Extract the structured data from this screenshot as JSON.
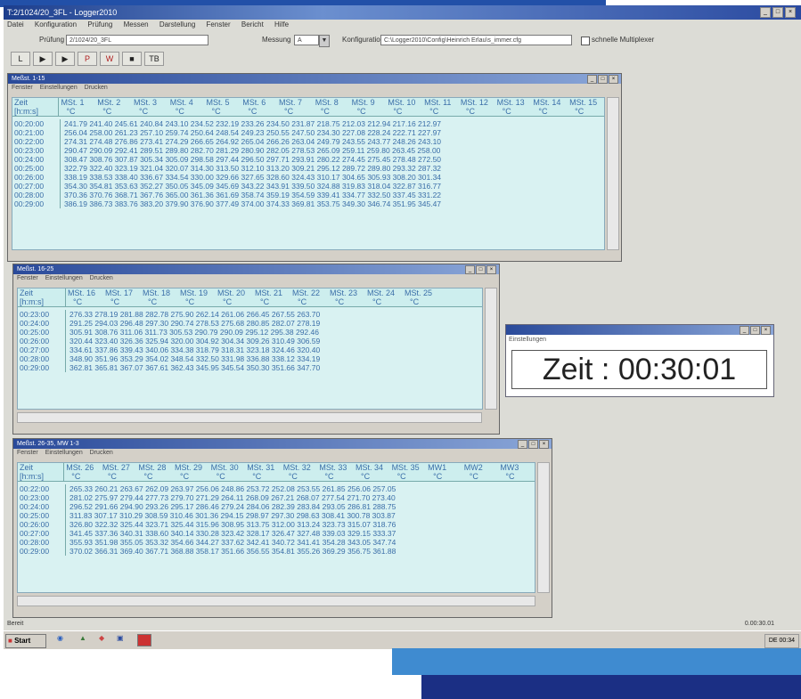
{
  "app": {
    "title": "T:2/1024/20_3FL - Logger2010",
    "menu": [
      "Datei",
      "Konfiguration",
      "Prüfung",
      "Messen",
      "Darstellung",
      "Fenster",
      "Bericht",
      "Hilfe"
    ],
    "pruefung_label": "Prüfung",
    "pruefung_value": "2/1024/20_3FL",
    "messung_label": "Messung",
    "messung_value": "A",
    "konfig_label": "Konfiguration",
    "konfig_value": "C:\\Logger2010\\Config\\Heinrich Erlau\\s_immer.cfg",
    "multiplexer_label": "schnelle Multiplexer",
    "toolbar": [
      "L",
      "▶",
      "▶",
      "P",
      "W",
      "■",
      "TB"
    ]
  },
  "win1": {
    "title": "Meßst. 1-15",
    "menu": [
      "Fenster",
      "Einstellungen",
      "Drucken"
    ],
    "time_header": [
      "Zeit",
      "[h:m:s]"
    ],
    "columns": [
      "MSt. 1",
      "MSt. 2",
      "MSt. 3",
      "MSt. 4",
      "MSt. 5",
      "MSt. 6",
      "MSt. 7",
      "MSt. 8",
      "MSt. 9",
      "MSt. 10",
      "MSt. 11",
      "MSt. 12",
      "MSt. 13",
      "MSt. 14",
      "MSt. 15"
    ],
    "unit": "°C",
    "rows": [
      {
        "t": "00:20:00",
        "v": "241.79 241.40 245.61 240.84 243.10 234.52 232.19 233.26 234.50 231.87 218.75 212.03 212.94 217.16 212.97"
      },
      {
        "t": "00:21:00",
        "v": "256.04 258.00 261.23 257.10 259.74 250.64 248.54 249.23 250.55 247.50 234.30 227.08 228.24 222.71 227.97"
      },
      {
        "t": "00:22:00",
        "v": "274.31 274.48 276.86 273.41 274.29 266.65 264.92 265.04 266.26 263.04 249.79 243.55 243.77 248.26 243.10"
      },
      {
        "t": "00:23:00",
        "v": "290.47 290.09 292.41 289.51 289.80 282.70 281.29 280.90 282.05 278.53 265.09 259.11 259.80 263.45 258.00"
      },
      {
        "t": "00:24:00",
        "v": "308.47 308.76 307.87 305.34 305.09 298.58 297.44 296.50 297.71 293.91 280.22 274.45 275.45 278.48 272.50"
      },
      {
        "t": "00:25:00",
        "v": "322.79 322.40 323.19 321.04 320.07 314.30 313.50 312.10 313.20 309.21 295.12 289.72 289.80 293.32 287.32"
      },
      {
        "t": "00:26:00",
        "v": "338.19 338.53 338.40 336.67 334.54 330.00 329.66 327.65 328.60 324.43 310.17 304.65 305.93 308.20 301.34"
      },
      {
        "t": "00:27:00",
        "v": "354.30 354.81 353.63 352.27 350.05 345.09 345.69 343.22 343.91 339.50 324.88 319.83 318.04 322.87 316.77"
      },
      {
        "t": "00:28:00",
        "v": "370.36 370.76 368.71 367.76 365.00 361.36 361.69 358.74 359.19 354.59 339.41 334.77 332.50 337.45 331.22"
      },
      {
        "t": "00:29:00",
        "v": "386.19 386.73 383.76 383.20 379.90 376.90 377.49 374.00 374.33 369.81 353.75 349.30 346.74 351.95 345.47"
      }
    ]
  },
  "win2": {
    "title": "Meßst. 16-25",
    "menu": [
      "Fenster",
      "Einstellungen",
      "Drucken"
    ],
    "time_header": [
      "Zeit",
      "[h:m:s]"
    ],
    "columns": [
      "MSt. 16",
      "MSt. 17",
      "MSt. 18",
      "MSt. 19",
      "MSt. 20",
      "MSt. 21",
      "MSt. 22",
      "MSt. 23",
      "MSt. 24",
      "MSt. 25"
    ],
    "unit": "°C",
    "rows": [
      {
        "t": "00:23:00",
        "v": "276.33 278.19 281.88 282.78 275.90 262.14 261.06 266.45 267.55 263.70"
      },
      {
        "t": "00:24:00",
        "v": "291.25 294.03 296.48 297.30 290.74 278.53 275.68 280.85 282.07 278.19"
      },
      {
        "t": "00:25:00",
        "v": "305.91 308.76 311.06 311.73 305.53 290.79 290.09 295.12 295.38 292.46"
      },
      {
        "t": "00:26:00",
        "v": "320.44 323.40 326.36 325.94 320.00 304.92 304.34 309.26 310.49 306.59"
      },
      {
        "t": "00:27:00",
        "v": "334.61 337.86 339.43 340.06 334.38 318.79 318.31 323.18 324.46 320.40"
      },
      {
        "t": "00:28:00",
        "v": "348.90 351.96 353.29 354.02 348.54 332.50 331.98 336.88 338.12 334.19"
      },
      {
        "t": "00:29:00",
        "v": "362.81 365.81 367.07 367.61 362.43 345.95 345.54 350.30 351.66 347.70"
      }
    ]
  },
  "win3": {
    "title": "Meßst. 26-35, MW 1-3",
    "menu": [
      "Fenster",
      "Einstellungen",
      "Drucken"
    ],
    "time_header": [
      "Zeit",
      "[h:m:s]"
    ],
    "columns": [
      "MSt. 26",
      "MSt. 27",
      "MSt. 28",
      "MSt. 29",
      "MSt. 30",
      "MSt. 31",
      "MSt. 32",
      "MSt. 33",
      "MSt. 34",
      "MSt. 35",
      "MW1",
      "MW2",
      "MW3"
    ],
    "unit": "°C",
    "rows": [
      {
        "t": "00:22:00",
        "v": "265.33 260.21 263.67 262.09 263.97 256.06 248.86 253.72 252.08 253.55 261.85 256.06 257.05"
      },
      {
        "t": "00:23:00",
        "v": "281.02 275.97 279.44 277.73 279.70 271.29 264.11 268.09 267.21 268.07 277.54 271.70 273.40"
      },
      {
        "t": "00:24:00",
        "v": "296.52 291.66 294.90 293.26 295.17 286.46 279.24 284.06 282.39 283.84 293.05 286.81 288.75"
      },
      {
        "t": "00:25:00",
        "v": "311.83 307.17 310.29 308.59 310.46 301.36 294.15 298.97 297.30 298.63 308.41 300.78 303.87"
      },
      {
        "t": "00:26:00",
        "v": "326.80 322.32 325.44 323.71 325.44 315.96 308.95 313.75 312.00 313.24 323.73 315.07 318.76"
      },
      {
        "t": "00:27:00",
        "v": "341.45 337.36 340.31 338.60 340.14 330.28 323.42 328.17 326.47 327.48 339.03 329.15 333.37"
      },
      {
        "t": "00:28:00",
        "v": "355.93 351.98 355.05 353.32 354.66 344.27 337.62 342.41 340.72 341.41 354.28 343.05 347.74"
      },
      {
        "t": "00:29:00",
        "v": "370.02 366.31 369.40 367.71 368.88 358.17 351.66 356.55 354.81 355.26 369.29 356.75 361.88"
      }
    ]
  },
  "clock": {
    "menu": "Einstellungen",
    "value": "Zeit : 00:30:01"
  },
  "status": {
    "left": "Bereit",
    "right": "0.00:30.01"
  },
  "taskbar": {
    "start": "Start",
    "tray": "DE  00:34"
  }
}
